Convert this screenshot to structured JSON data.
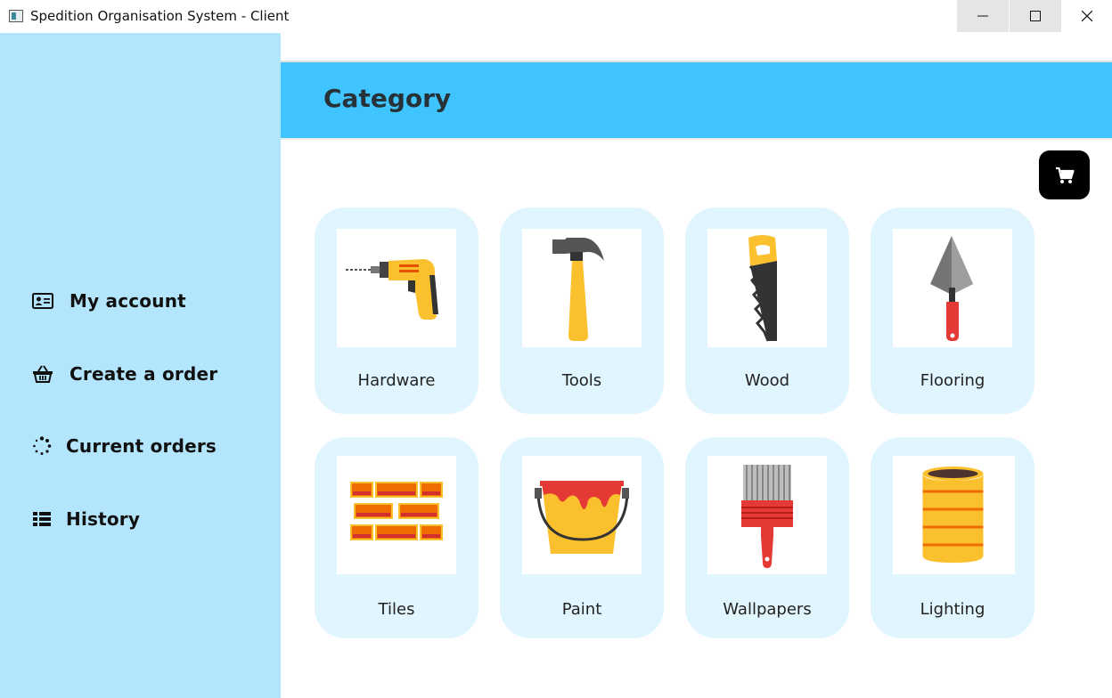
{
  "window": {
    "title": "Spedition Organisation System - Client"
  },
  "sidebar": {
    "items": [
      {
        "label": "My account",
        "icon": "id-card-icon"
      },
      {
        "label": "Create a order",
        "icon": "basket-icon"
      },
      {
        "label": "Current orders",
        "icon": "spinner-icon"
      },
      {
        "label": "History",
        "icon": "list-icon"
      }
    ]
  },
  "header": {
    "title": "Category"
  },
  "cart": {
    "icon": "cart-icon"
  },
  "categories": [
    {
      "label": "Hardware",
      "icon": "drill-icon"
    },
    {
      "label": "Tools",
      "icon": "hammer-icon"
    },
    {
      "label": "Wood",
      "icon": "saw-icon"
    },
    {
      "label": "Flooring",
      "icon": "trowel-icon"
    },
    {
      "label": "Tiles",
      "icon": "bricks-icon"
    },
    {
      "label": "Paint",
      "icon": "paint-bucket-icon"
    },
    {
      "label": "Wallpapers",
      "icon": "paint-brush-icon"
    },
    {
      "label": "Lighting",
      "icon": "barrel-icon"
    }
  ],
  "colors": {
    "sidebar_bg": "#b3e5fc",
    "header_bg": "#40c4ff",
    "tile_bg": "#e1f5fe",
    "cart_bg": "#000000"
  }
}
